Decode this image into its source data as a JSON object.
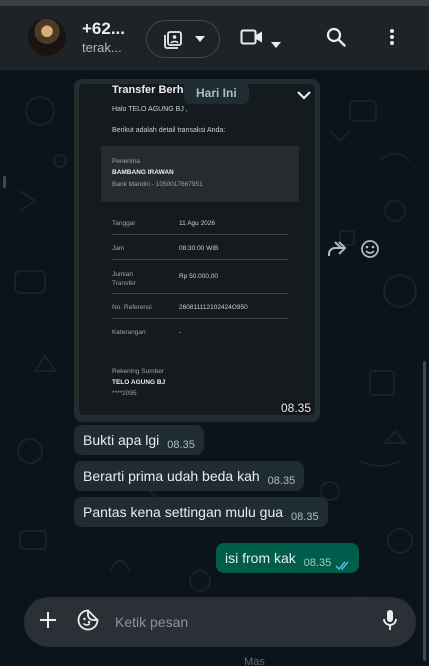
{
  "header": {
    "name": "+62...",
    "status": "terak...",
    "icons": [
      "media-gallery-icon",
      "chevron-down-icon",
      "video-call-icon",
      "search-icon",
      "more-vert-icon"
    ]
  },
  "chat": {
    "date_chip": "Hari Ini",
    "image_message": {
      "time": "08.35",
      "receipt": {
        "title": "Transfer Berha",
        "greeting": "Halo TELO AGUNG BJ ,",
        "intro": "Berikut adalah detail transaksi Anda:",
        "recipient_label": "Penerima",
        "recipient_name": "BAMBANG IRAWAN",
        "recipient_bank": "Bank Mandiri - 1050017667951",
        "rows": [
          {
            "label": "Tanggal",
            "value": "11 Agu 2026"
          },
          {
            "label": "Jam",
            "value": "08:30:00 WIB"
          },
          {
            "label": "Jumlah Transfer",
            "value": "Rp 50.000,00"
          },
          {
            "label": "No. Referensi",
            "value": "260811112102424O950"
          },
          {
            "label": "Keterangan",
            "value": "-"
          }
        ],
        "source_label": "Rekening Sumber",
        "source_name": "TELO AGUNG BJ",
        "source_account": "****2095"
      }
    },
    "messages": [
      {
        "direction": "in",
        "text": "Bukti apa lgi",
        "time": "08.35"
      },
      {
        "direction": "in",
        "text": "Berarti prima udah beda kah",
        "time": "08.35"
      },
      {
        "direction": "in",
        "text": "Pantas kena settingan mulu gua",
        "time": "08.35"
      },
      {
        "direction": "out",
        "text": "isi from kak",
        "time": "08.35",
        "status": "read"
      }
    ]
  },
  "composer": {
    "placeholder": "Ketik pesan",
    "icons": [
      "plus-icon",
      "sticker-icon",
      "mic-icon"
    ]
  },
  "bottom_peek": "Mas"
}
